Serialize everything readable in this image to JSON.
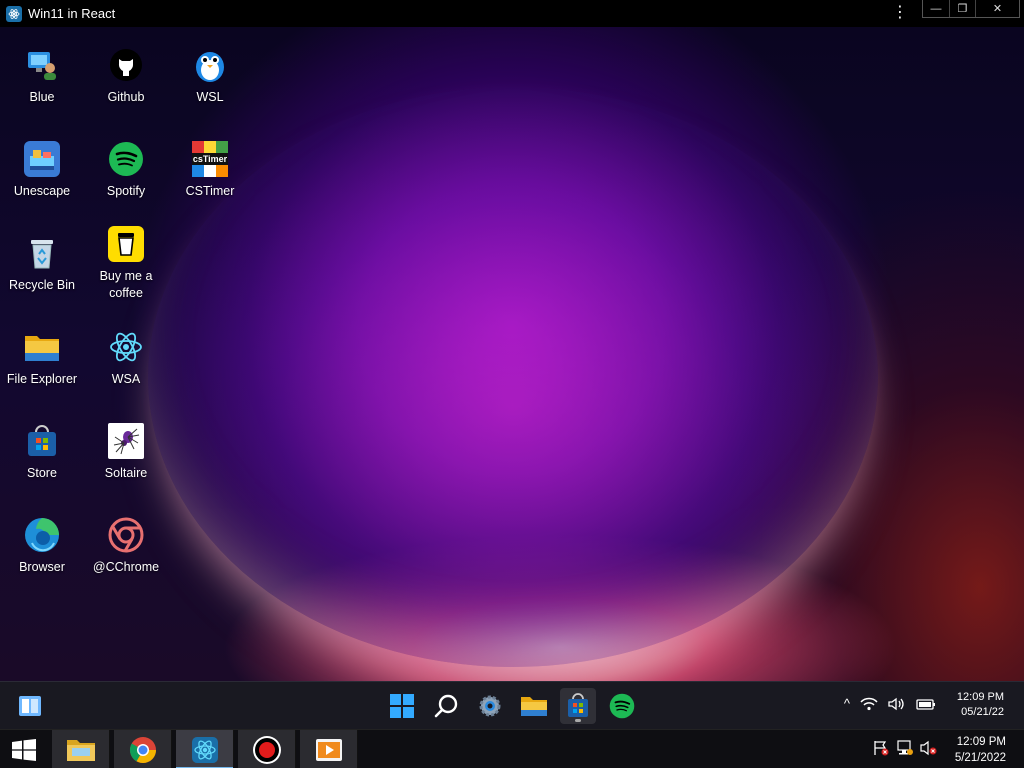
{
  "host_window": {
    "title": "Win11 in React",
    "kebab": "⋮",
    "minimize": "—",
    "restore": "❐",
    "close": "✕"
  },
  "desktop_icons": [
    {
      "label": "Blue",
      "icon": "user-pc-icon"
    },
    {
      "label": "Github",
      "icon": "github-icon"
    },
    {
      "label": "WSL",
      "icon": "penguin-icon"
    },
    {
      "label": "Unescape",
      "icon": "unescape-icon"
    },
    {
      "label": "Spotify",
      "icon": "spotify-icon"
    },
    {
      "label": "CSTimer",
      "icon": "cstimer-icon"
    },
    {
      "label": "Recycle Bin",
      "icon": "recycle-bin-icon"
    },
    {
      "label": "Buy me a coffee",
      "icon": "coffee-cup-icon"
    },
    {
      "label": "File Explorer",
      "icon": "folder-icon"
    },
    {
      "label": "WSA",
      "icon": "react-atom-icon"
    },
    {
      "label": "Store",
      "icon": "store-icon"
    },
    {
      "label": "Soltaire",
      "icon": "spider-icon"
    },
    {
      "label": "Browser",
      "icon": "edge-icon"
    },
    {
      "label": "@CChrome",
      "icon": "cchrome-icon"
    }
  ],
  "cstimer_text": "csTimer",
  "taskbar11": {
    "widgets": "widgets-icon",
    "pinned": [
      "windows-start-icon",
      "search-icon",
      "settings-icon",
      "file-explorer-icon",
      "store-icon",
      "spotify-icon"
    ],
    "tray_chevron": "^",
    "time": "12:09 PM",
    "date": "05/21/22"
  },
  "taskbar10": {
    "apps": [
      "file-explorer-icon",
      "chrome-icon",
      "react-app-icon",
      "record-icon",
      "media-player-icon"
    ],
    "time": "12:09 PM",
    "date": "5/21/2022"
  },
  "colors": {
    "accent": "#0078d4",
    "spotify": "#1db954",
    "folder": "#f5c842"
  }
}
